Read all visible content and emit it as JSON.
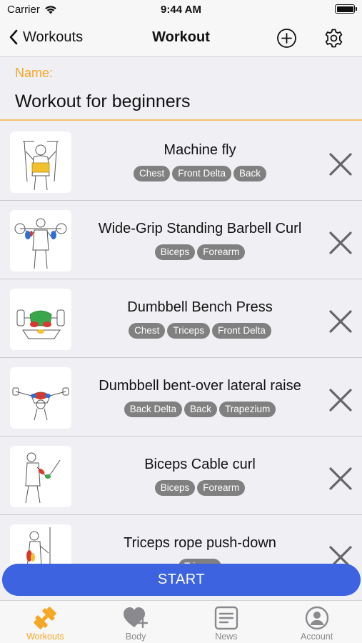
{
  "status_bar": {
    "carrier": "Carrier",
    "time": "9:44 AM"
  },
  "nav": {
    "back_label": "Workouts",
    "title": "Workout"
  },
  "name": {
    "label": "Name:",
    "value": "Workout for beginners"
  },
  "exercises": [
    {
      "title": "Machine fly",
      "tags": [
        "Chest",
        "Front Delta",
        "Back"
      ]
    },
    {
      "title": "Wide-Grip Standing Barbell Curl",
      "tags": [
        "Biceps",
        "Forearm"
      ]
    },
    {
      "title": "Dumbbell Bench Press",
      "tags": [
        "Chest",
        "Triceps",
        "Front Delta"
      ]
    },
    {
      "title": "Dumbbell bent-over lateral raise",
      "tags": [
        "Back Delta",
        "Back",
        "Trapezium"
      ]
    },
    {
      "title": "Biceps Cable curl",
      "tags": [
        "Biceps",
        "Forearm"
      ]
    },
    {
      "title": "Triceps rope push-down",
      "tags": [
        "Triceps"
      ]
    }
  ],
  "start_label": "START",
  "tabs": [
    {
      "label": "Workouts",
      "icon": "dumbbell-icon",
      "active": true
    },
    {
      "label": "Body",
      "icon": "heart-plus-icon",
      "active": false
    },
    {
      "label": "News",
      "icon": "news-icon",
      "active": false
    },
    {
      "label": "Account",
      "icon": "account-icon",
      "active": false
    }
  ],
  "colors": {
    "accent": "#f5a623",
    "start_button": "#3d63e0",
    "tag_bg": "#808080"
  }
}
